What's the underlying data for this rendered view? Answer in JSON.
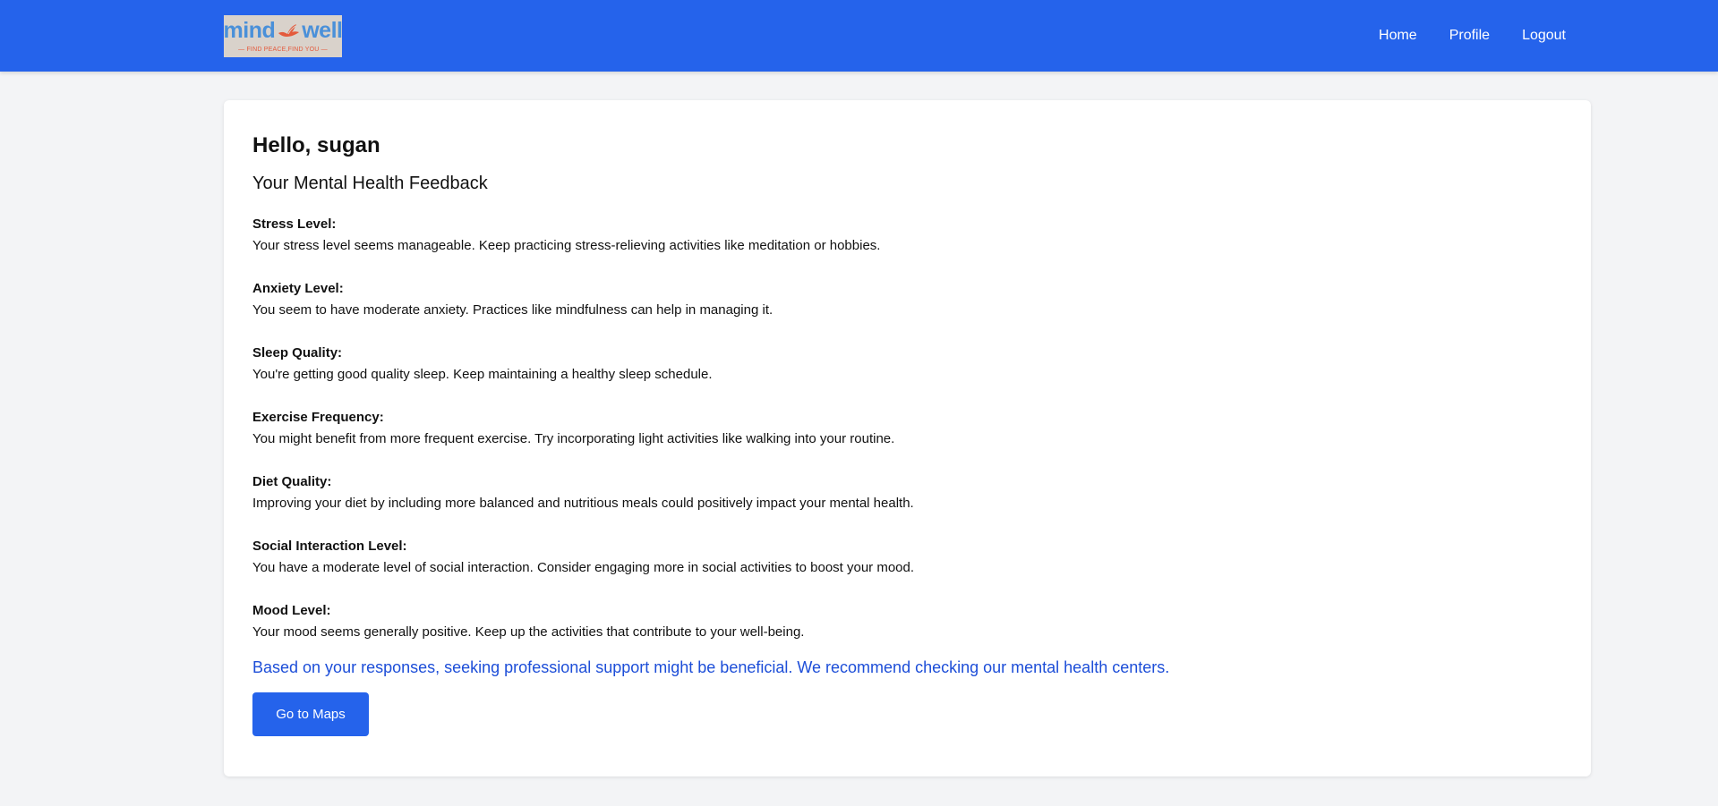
{
  "header": {
    "logo": {
      "left_text": "mind",
      "right_text": "well",
      "tagline": "— FIND PEACE,FIND YOU —",
      "icon": "bird-icon"
    },
    "nav": [
      {
        "label": "Home"
      },
      {
        "label": "Profile"
      },
      {
        "label": "Logout"
      }
    ],
    "colors": {
      "navbar": "#2563eb",
      "logo_blue": "#4a90d9",
      "logo_orange": "#e45a3c"
    }
  },
  "main": {
    "greeting": "Hello, sugan",
    "section_title": "Your Mental Health Feedback",
    "feedback": [
      {
        "label": "Stress Level:",
        "text": "Your stress level seems manageable. Keep practicing stress-relieving activities like meditation or hobbies."
      },
      {
        "label": "Anxiety Level:",
        "text": "You seem to have moderate anxiety. Practices like mindfulness can help in managing it."
      },
      {
        "label": "Sleep Quality:",
        "text": "You're getting good quality sleep. Keep maintaining a healthy sleep schedule."
      },
      {
        "label": "Exercise Frequency:",
        "text": "You might benefit from more frequent exercise. Try incorporating light activities like walking into your routine."
      },
      {
        "label": "Diet Quality:",
        "text": "Improving your diet by including more balanced and nutritious meals could positively impact your mental health."
      },
      {
        "label": "Social Interaction Level:",
        "text": "You have a moderate level of social interaction. Consider engaging more in social activities to boost your mood."
      },
      {
        "label": "Mood Level:",
        "text": "Your mood seems generally positive. Keep up the activities that contribute to your well-being."
      }
    ],
    "recommendation": "Based on your responses, seeking professional support might be beneficial. We recommend checking our mental health centers.",
    "maps_button": "Go to Maps",
    "colors": {
      "accent": "#2563eb",
      "recommendation_text": "#1d4ed8",
      "page_background": "#f3f4f6"
    }
  }
}
